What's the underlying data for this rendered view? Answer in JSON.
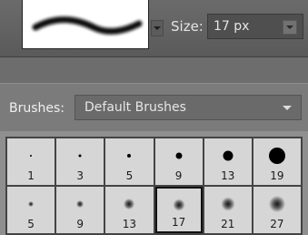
{
  "size": {
    "label": "Size:",
    "value": "17 px"
  },
  "brushes": {
    "label": "Brushes:",
    "selected": "Default Brushes"
  },
  "brush_grid": [
    {
      "size": "1",
      "style": "hard"
    },
    {
      "size": "3",
      "style": "hard"
    },
    {
      "size": "5",
      "style": "hard"
    },
    {
      "size": "9",
      "style": "hard"
    },
    {
      "size": "13",
      "style": "hard"
    },
    {
      "size": "19",
      "style": "hard"
    },
    {
      "size": "5",
      "style": "soft"
    },
    {
      "size": "9",
      "style": "soft"
    },
    {
      "size": "13",
      "style": "soft"
    },
    {
      "size": "17",
      "style": "soft",
      "selected": true
    },
    {
      "size": "21",
      "style": "soft"
    },
    {
      "size": "27",
      "style": "soft"
    }
  ]
}
